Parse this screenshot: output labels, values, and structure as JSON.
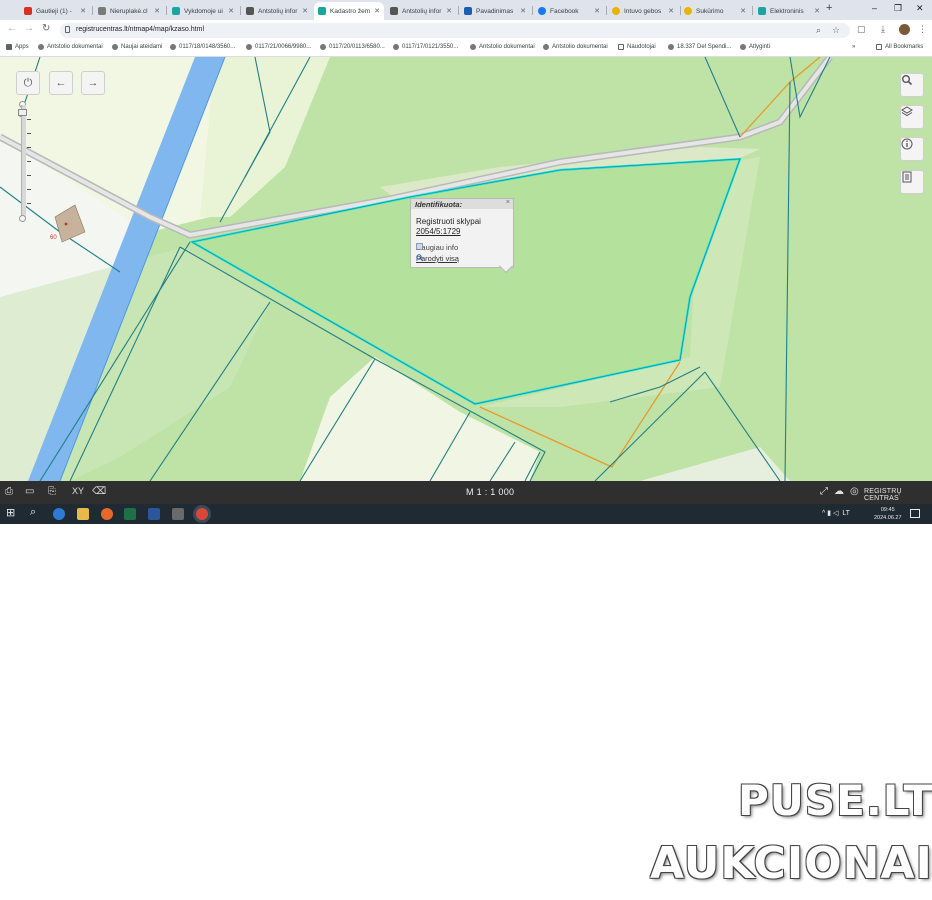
{
  "browser": {
    "tabs": [
      {
        "label": "Gautieji (1) - ",
        "color": "#d93025",
        "active": false
      },
      {
        "label": "Nieruplakė.cl",
        "color": "#7a7a7a",
        "active": false
      },
      {
        "label": "Vykdomoje ui",
        "color": "#1aa6a0",
        "active": false
      },
      {
        "label": "Antstolių infor",
        "color": "#555555",
        "active": false
      },
      {
        "label": "Kadastro žem",
        "color": "#1aa6a0",
        "active": true
      },
      {
        "label": "Antstolių infor",
        "color": "#555555",
        "active": false
      },
      {
        "label": "Pavadinimas",
        "color": "#1a5fb4",
        "active": false
      },
      {
        "label": "Facebook",
        "color": "#1877f2",
        "active": false
      },
      {
        "label": "Intuvo gebos",
        "color": "#e8b400",
        "active": false
      },
      {
        "label": "Sukūrimo",
        "color": "#e8b400",
        "active": false
      },
      {
        "label": "Elektroninis",
        "color": "#1aa6a0",
        "active": false
      }
    ],
    "new_tab_label": "+",
    "window_controls": {
      "minimize": "–",
      "restore": "❐",
      "close": "✕"
    },
    "url": "registrucentras.lt/ntmap4/map/kzaso.html",
    "bookmarks": [
      {
        "label": "Apps",
        "color": "#5f6368"
      },
      {
        "label": "Antstolio dokumentai",
        "color": "#555555"
      },
      {
        "label": "Naujai ateidami",
        "color": "#555555"
      },
      {
        "label": "0117/18/0148/3560...",
        "color": "#555555"
      },
      {
        "label": "0117/21/0066/9980...",
        "color": "#555555"
      },
      {
        "label": "0117/20/0113/6580...",
        "color": "#555555"
      },
      {
        "label": "0117/17/0121/3550...",
        "color": "#555555"
      },
      {
        "label": "Antstolio dokumentai",
        "color": "#555555"
      },
      {
        "label": "Antstolio dokumentai",
        "color": "#555555"
      },
      {
        "label": "Naudotojai",
        "color": "#555555"
      },
      {
        "label": "18.337 Del Spendi...",
        "color": "#555555"
      },
      {
        "label": "Atlyginti",
        "color": "#555555"
      }
    ],
    "all_bookmarks": "All Bookmarks"
  },
  "map": {
    "left_controls": {
      "power_icon": "⏻",
      "back_icon": "←",
      "forward_icon": "→"
    },
    "right_controls": [
      "search-icon",
      "layers-icon",
      "info-icon",
      "legend-icon"
    ],
    "popup": {
      "title": "Identifikuota:",
      "close": "×",
      "label": "Registruoti sklypai",
      "parcel_number": "2054/5:1729",
      "more_info": "Daugiau info",
      "show_all": "Parodyti visą"
    }
  },
  "map_bar": {
    "scale": "M 1 : 1 000",
    "xy_label": "XY",
    "brand": "REGISTRŲ CENTRAS"
  },
  "taskbar": {
    "language": "LT",
    "time": "09:45",
    "date": "2024.06.27"
  },
  "watermark": {
    "line1": "PUSE.LT",
    "line2": "AUKCIONAI"
  }
}
